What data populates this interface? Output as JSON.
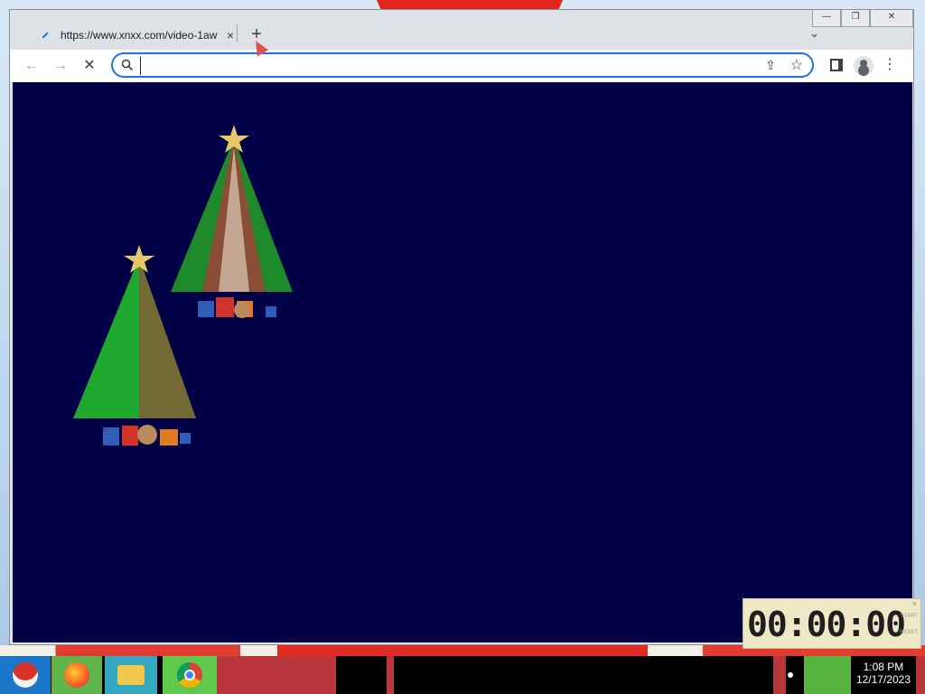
{
  "browser": {
    "tab": {
      "title": "https://www.xnxx.com/video-1aw",
      "close_label": "×"
    },
    "new_tab_label": "+",
    "tab_search_label": "⌄",
    "window_controls": {
      "minimize": "—",
      "restore": "❐",
      "close": "✕"
    },
    "toolbar": {
      "back_label": "←",
      "forward_label": "→",
      "stop_label": "✕",
      "omnibox_value": "",
      "omnibox_placeholder": "",
      "share_label": "⇪",
      "bookmark_label": "☆",
      "menu_label": "⋮"
    },
    "page_background": "#000046"
  },
  "clock_widget": {
    "digits": "00:00:00",
    "start_label": "START",
    "reset_label": "RESET",
    "close_label": "×"
  },
  "taskbar": {
    "time": "1:08 PM",
    "date": "12/17/2023",
    "apps": [
      "start-santa-icon",
      "firefox-icon",
      "file-explorer-icon",
      "chrome-icon"
    ]
  }
}
